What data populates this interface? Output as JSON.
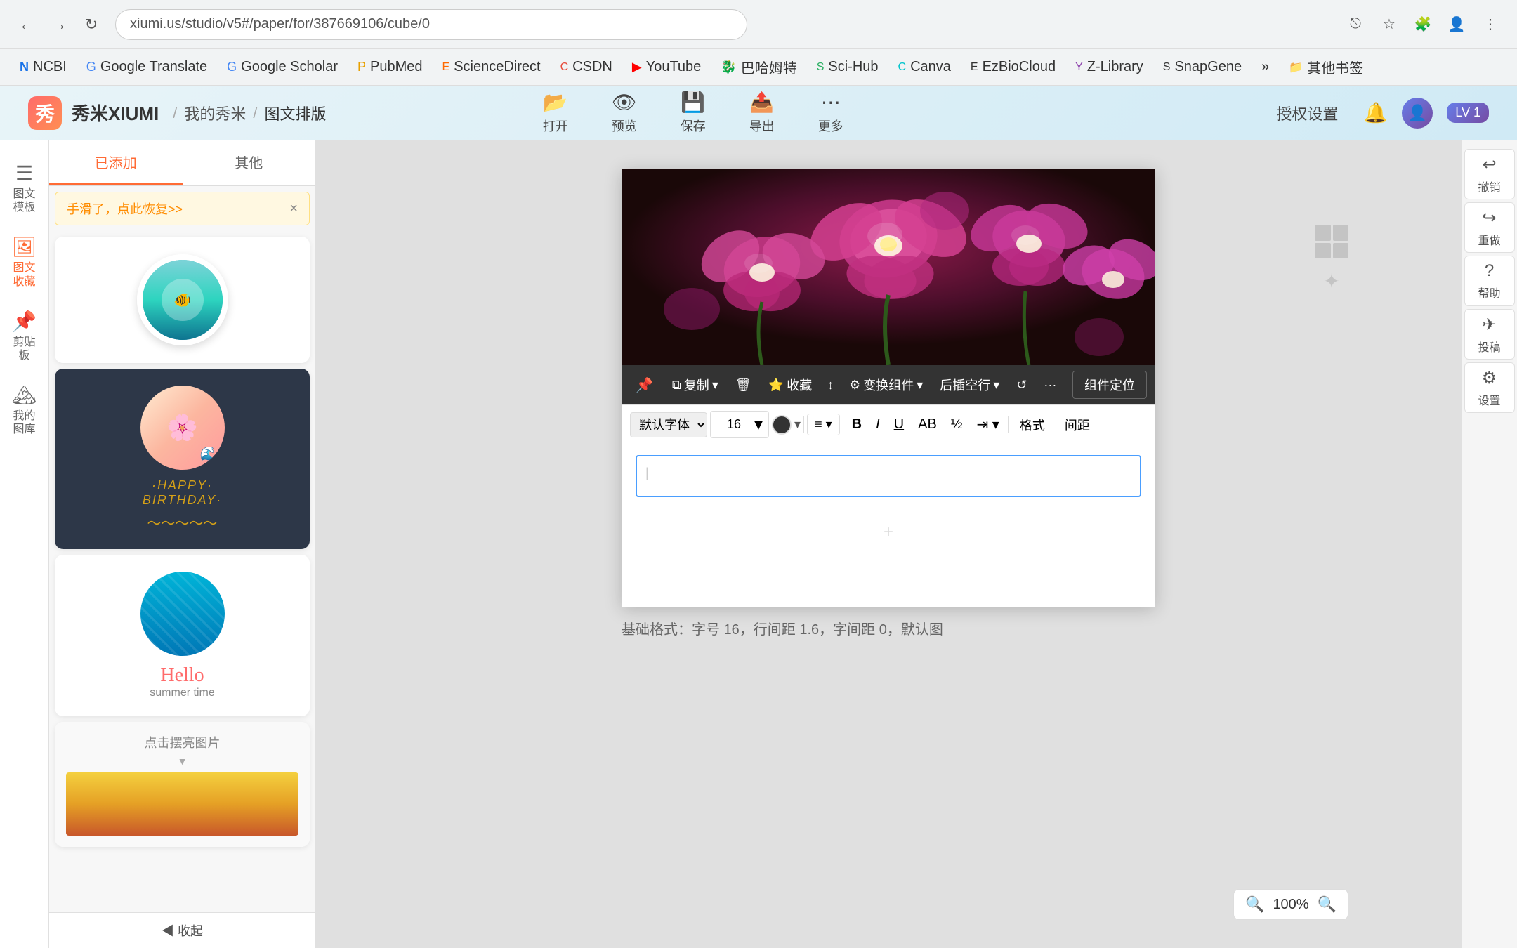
{
  "browser": {
    "back_btn": "←",
    "forward_btn": "→",
    "reload_btn": "↻",
    "url": "xiumi.us/studio/v5#/paper/for/387669106/cube/0",
    "star_icon": "☆",
    "account_icon": "👤"
  },
  "bookmarks": [
    {
      "label": "NCBI",
      "color": "#1a73e8"
    },
    {
      "label": "Google Translate",
      "color": "#4285f4"
    },
    {
      "label": "Google Scholar",
      "color": "#4285f4"
    },
    {
      "label": "PubMed",
      "color": "#e8a000"
    },
    {
      "label": "ScienceDirect",
      "color": "#ff6900"
    },
    {
      "label": "CSDN",
      "color": "#e74c3c"
    },
    {
      "label": "YouTube",
      "color": "#ff0000"
    },
    {
      "label": "巴哈姆特",
      "color": "#666"
    },
    {
      "label": "Sci-Hub",
      "color": "#27ae60"
    },
    {
      "label": "Canva",
      "color": "#00c4cc"
    },
    {
      "label": "EzBioCloud",
      "color": "#333"
    },
    {
      "label": "Z-Library",
      "color": "#8e44ad"
    },
    {
      "label": "SnapGene",
      "color": "#e74c3c"
    },
    {
      "label": "»",
      "color": "#666"
    },
    {
      "label": "其他书签",
      "color": "#666"
    }
  ],
  "header": {
    "logo_text": "秀米XIUMI",
    "breadcrumb_sep": "/",
    "breadcrumb_1": "我的秀米",
    "breadcrumb_2": "/",
    "breadcrumb_3": "图文排版",
    "toolbar_items": [
      {
        "icon": "📁",
        "label": "打开"
      },
      {
        "icon": "👁",
        "label": "预览"
      },
      {
        "icon": "💾",
        "label": "保存"
      },
      {
        "icon": "📤",
        "label": "导出"
      },
      {
        "icon": "⋯",
        "label": "更多"
      }
    ],
    "auth_label": "授权设置",
    "bell_icon": "🔔",
    "level": "LV 1"
  },
  "sidebar": {
    "items": [
      {
        "icon": "☰",
        "label": "图文模板",
        "active": false
      },
      {
        "icon": "🖼",
        "label": "图文收藏",
        "active": true
      },
      {
        "icon": "📌",
        "label": "剪贴板",
        "active": false
      },
      {
        "icon": "🏔",
        "label": "我的图库",
        "active": false
      }
    ]
  },
  "panel": {
    "tabs": [
      "已添加",
      "其他"
    ],
    "restore_text": "手滑了，点此恢复>>",
    "restore_close": "×",
    "templates": [
      {
        "type": "teal_circle",
        "name": "teal circle photo"
      },
      {
        "type": "birthday",
        "text1": "·HAPPY·",
        "text2": "BIRTHDAY·"
      },
      {
        "type": "summer",
        "hello": "Hello",
        "sub": "summer time"
      },
      {
        "type": "photo_click",
        "label": "点击摆亮图片"
      }
    ]
  },
  "canvas": {
    "toolbar_top": {
      "pin_icon": "📌",
      "copy_label": "复制",
      "delete_icon": "🗑",
      "collect_label": "收藏",
      "move_icon": "↕",
      "transform_label": "变换组件",
      "insert_label": "后插空行",
      "rotate_icon": "↺",
      "more_icon": "···",
      "position_label": "组件定位"
    },
    "toolbar_bottom": {
      "font_label": "默认字体",
      "font_size": "16",
      "color_circle": "#333333",
      "align_icon": "≡",
      "bold": "B",
      "italic": "I",
      "underline": "U",
      "strikethrough": "AB",
      "formula": "½",
      "indent_icon": "⇥",
      "format_label": "格式",
      "spacing_label": "间距"
    },
    "text_placeholder": "+",
    "status_text": "基础格式：字号 16，行间距 1.6，字间距 0，默认图"
  },
  "right_panel": {
    "buttons": [
      {
        "icon": "↩",
        "label": "撤销"
      },
      {
        "icon": "↪",
        "label": "重做"
      },
      {
        "icon": "?",
        "label": "帮助"
      },
      {
        "icon": "✈",
        "label": "投稿"
      },
      {
        "icon": "⚙",
        "label": "设置"
      }
    ]
  },
  "zoom": {
    "zoom_in_icon": "🔍-",
    "level": "100%",
    "zoom_out_icon": "🔍+"
  }
}
